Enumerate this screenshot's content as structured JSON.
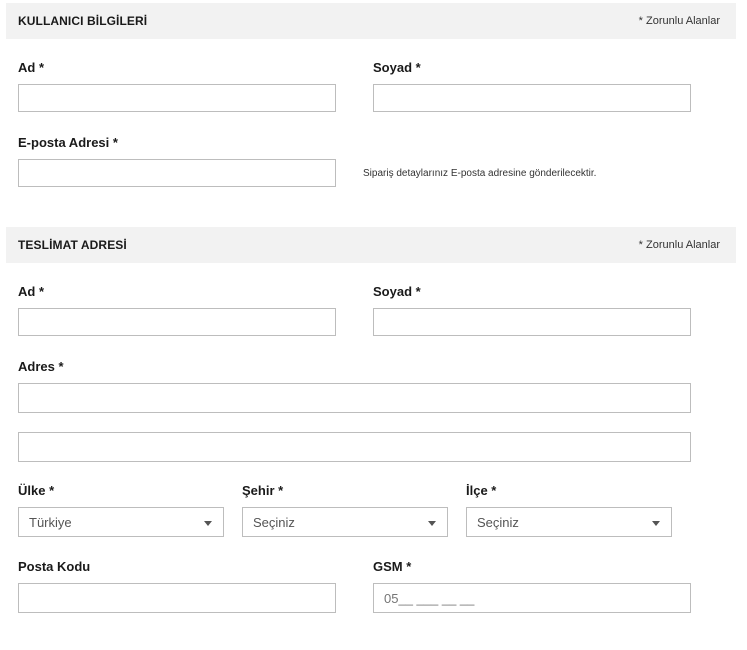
{
  "required_note": "* Zorunlu Alanlar",
  "user_info": {
    "title": "KULLANICI BİLGİLERİ",
    "first_name_label": "Ad *",
    "first_name_value": "",
    "last_name_label": "Soyad *",
    "last_name_value": "",
    "email_label": "E-posta Adresi *",
    "email_value": "",
    "email_hint": "Sipariş detaylarınız E-posta adresine gönderilecektir."
  },
  "delivery": {
    "title": "TESLİMAT ADRESİ",
    "first_name_label": "Ad *",
    "first_name_value": "",
    "last_name_label": "Soyad *",
    "last_name_value": "",
    "address_label": "Adres *",
    "address_line1_value": "",
    "address_line2_value": "",
    "country_label": "Ülke *",
    "country_value": "Türkiye",
    "city_label": "Şehir *",
    "city_value": "Seçiniz",
    "district_label": "İlçe *",
    "district_value": "Seçiniz",
    "postal_label": "Posta Kodu",
    "postal_value": "",
    "gsm_label": "GSM *",
    "gsm_placeholder": "05__ ___ __ __"
  },
  "icons": {
    "select_caret": "chevron-down-icon"
  }
}
